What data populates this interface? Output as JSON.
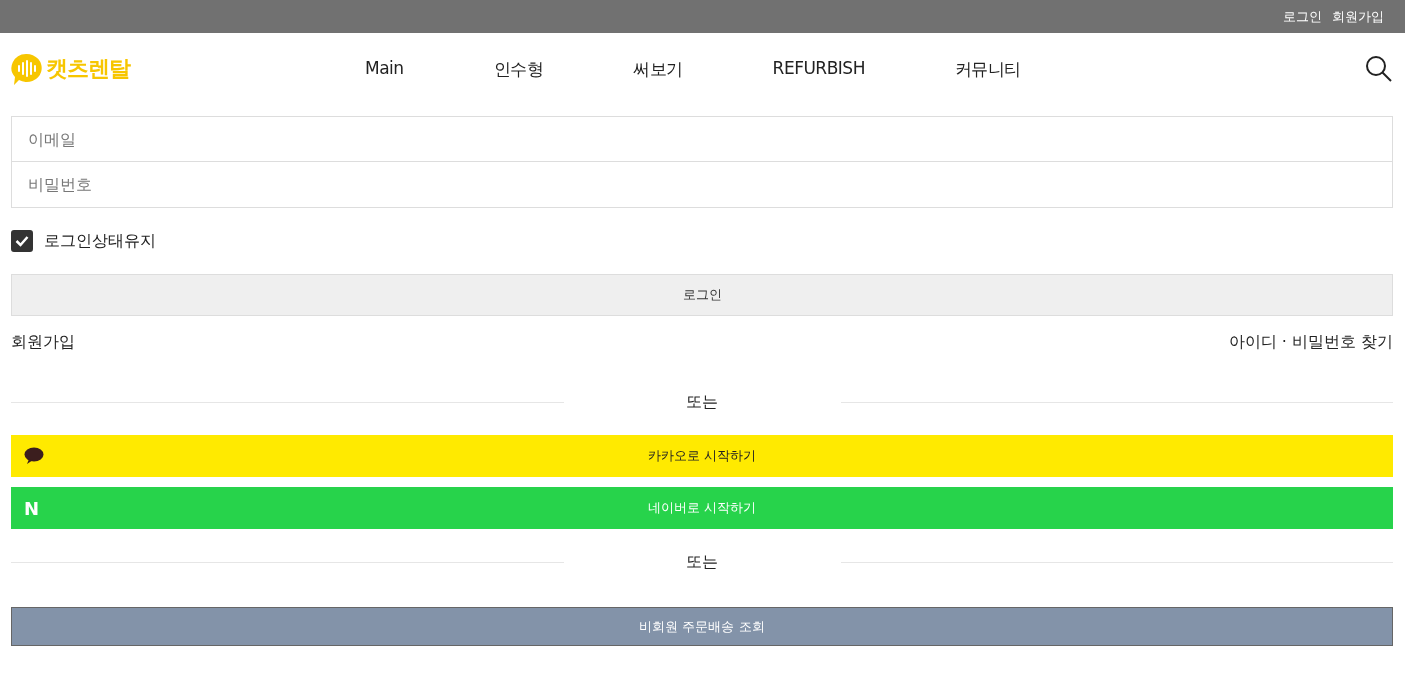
{
  "top_links": [
    {
      "label": "로그인"
    },
    {
      "label": "회원가입"
    }
  ],
  "logo": {
    "text": "캣츠렌탈"
  },
  "nav": [
    "Main",
    "인수형",
    "써보기",
    "REFURBISH",
    "커뮤니티"
  ],
  "form": {
    "email": {
      "placeholder": "이메일"
    },
    "password": {
      "placeholder": "비밀번호"
    },
    "remember": {
      "label": "로그인상태유지",
      "checked": true
    },
    "login_button": "로그인",
    "signup_link": "회원가입",
    "find_link": "아이디 · 비밀번호 찾기"
  },
  "divider_1": "또는",
  "social": [
    {
      "kind": "kakao",
      "label": "카카오로 시작하기"
    },
    {
      "kind": "naver",
      "icon": "N",
      "label": "네이버로 시작하기"
    }
  ],
  "divider_2": "또는",
  "guest_button": "비회원 주문배송 조회"
}
